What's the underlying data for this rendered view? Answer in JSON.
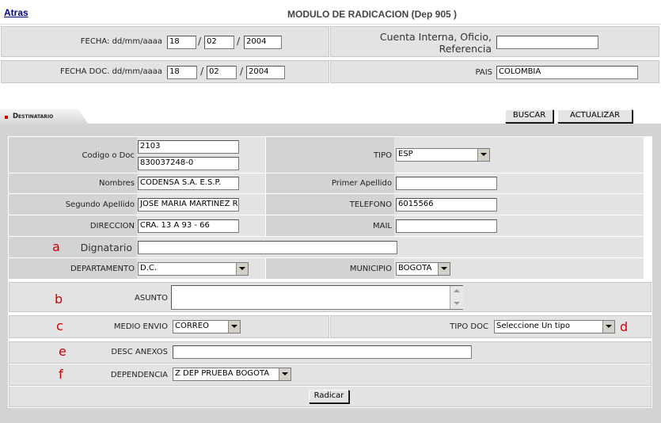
{
  "header": {
    "back_link": "Atras",
    "title": "MODULO DE RADICACION (Dep 905 )"
  },
  "dates": {
    "fecha_label": "FECHA: dd/mm/aaaa",
    "fecha_day": "18",
    "fecha_month": "02",
    "fecha_year": "2004",
    "cuenta_label": "Cuenta Interna, Oficio, Referencia",
    "cuenta_value": "",
    "fecha_doc_label": "FECHA DOC. dd/mm/aaaa",
    "fecha_doc_day": "18",
    "fecha_doc_month": "02",
    "fecha_doc_year": "2004",
    "pais_label": "PAIS",
    "pais_value": "COLOMBIA",
    "separator": "/"
  },
  "destinatario": {
    "tab_label": "Destinatario",
    "buscar_button": "BUSCAR",
    "actualizar_button": "ACTUALIZAR"
  },
  "form": {
    "codigo_label": "Codigo o Doc",
    "codigo_value_1": "2103",
    "codigo_value_2": "830037248-0",
    "tipo_label": "TIPO",
    "tipo_value": "ESP",
    "nombres_label": "Nombres",
    "nombres_value": "CODENSA S.A. E.S.P.",
    "primer_apellido_label": "Primer Apellido",
    "primer_apellido_value": "",
    "segundo_apellido_label": "Segundo Apellido",
    "segundo_apellido_value": "JOSE MARIA MARTINEZ R",
    "telefono_label": "TELEFONO",
    "telefono_value": "6015566",
    "direccion_label": "DIRECCION",
    "direccion_value": "CRA. 13 A  93 - 66",
    "mail_label": "MAIL",
    "mail_value": "",
    "dignatario_label": "Dignatario",
    "dignatario_value": "",
    "departamento_label": "DEPARTAMENTO",
    "departamento_value": "D.C.",
    "municipio_label": "MUNICIPIO",
    "municipio_value": "BOGOTA",
    "asunto_label": "ASUNTO",
    "asunto_value": "",
    "medio_envio_label": "MEDIO ENVIO",
    "medio_envio_value": "CORREO",
    "tipo_doc_label": "TIPO DOC",
    "tipo_doc_value": "Seleccione Un tipo",
    "desc_anexos_label": "DESC ANEXOS",
    "desc_anexos_value": "",
    "dependencia_label": "DEPENDENCIA",
    "dependencia_value": "Z DEP PRUEBA BOGOTA",
    "radicar_button": "Radicar"
  },
  "annotations": {
    "a": "a",
    "b": "b",
    "c": "c",
    "d": "d",
    "e": "e",
    "f": "f"
  },
  "colors": {
    "annotation": "#d00000",
    "panel": "#d3d3d3",
    "cell": "#e3e3e3",
    "link": "#00008b"
  }
}
